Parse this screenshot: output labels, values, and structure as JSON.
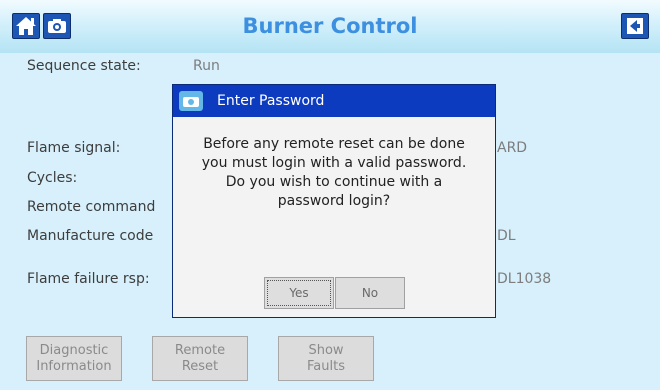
{
  "header": {
    "title": "Burner Control",
    "home_icon": "home-icon",
    "camera_icon": "camera-icon",
    "back_icon": "back-arrow-icon"
  },
  "form": {
    "sequence_state_label": "Sequence state:",
    "sequence_state_value": "Run",
    "flame_signal_label": "Flame signal:",
    "flame_signal_value": "ARD",
    "cycles_label": "Cycles:",
    "remote_command_label": "Remote command",
    "manufacture_code_label": "Manufacture code",
    "manufacture_code_value": "DL",
    "flame_failure_label": "Flame failure rsp:",
    "flame_failure_value": "DL1038"
  },
  "footer": {
    "diagnostic_line1": "Diagnostic",
    "diagnostic_line2": "Information",
    "remote_reset_line1": "Remote",
    "remote_reset_line2": "Reset",
    "show_faults_line1": "Show",
    "show_faults_line2": "Faults"
  },
  "dialog": {
    "title": "Enter Password",
    "message": "Before any remote reset can be done\nyou must login with a valid password.\nDo you wish to continue with a\npassword login?",
    "yes_label": "Yes",
    "no_label": "No",
    "icon": "camera-icon"
  },
  "colors": {
    "screen_bg": "#d7f0fb",
    "title": "#3d8fe0",
    "dialog_titlebar": "#0d3bc0",
    "header_button": "#1e56b4"
  }
}
